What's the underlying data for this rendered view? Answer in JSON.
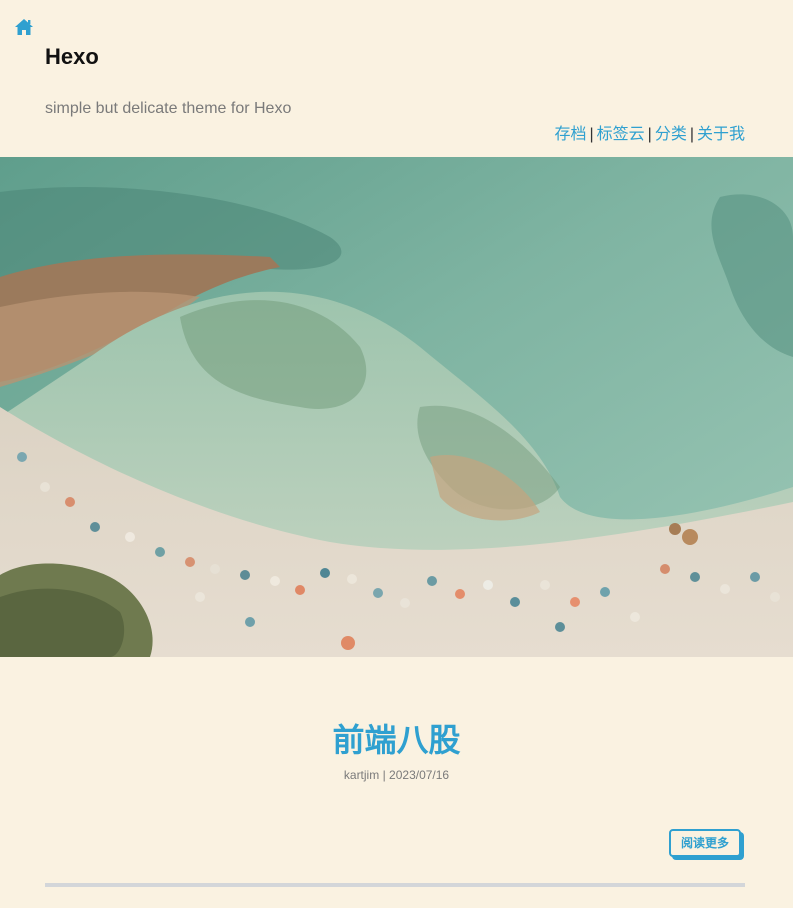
{
  "header": {
    "home_icon": "home-icon",
    "site_title": "Hexo",
    "site_subtitle": "simple but delicate theme for Hexo"
  },
  "nav": {
    "items": [
      {
        "label": "存档"
      },
      {
        "label": "标签云"
      },
      {
        "label": "分类"
      },
      {
        "label": "关于我"
      }
    ],
    "separator": "|"
  },
  "post": {
    "title": "前端八股",
    "author": "kartjim",
    "meta_separator": "|",
    "date": "2023/07/16",
    "read_more_label": "阅读更多"
  },
  "colors": {
    "background": "#faf2e1",
    "accent": "#2fa0d0",
    "divider": "#d3d6d9"
  }
}
